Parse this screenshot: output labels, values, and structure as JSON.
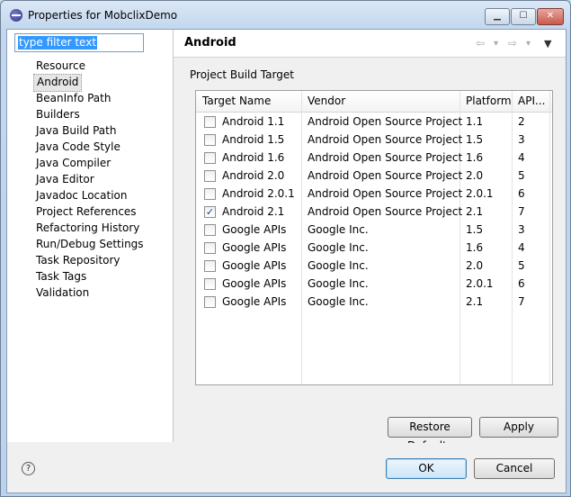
{
  "window": {
    "title": "Properties for MobclixDemo"
  },
  "filter": {
    "text": "type filter text"
  },
  "nav": {
    "items": [
      "Resource",
      "Android",
      "BeanInfo Path",
      "Builders",
      "Java Build Path",
      "Java Code Style",
      "Java Compiler",
      "Java Editor",
      "Javadoc Location",
      "Project References",
      "Refactoring History",
      "Run/Debug Settings",
      "Task Repository",
      "Task Tags",
      "Validation"
    ],
    "selected": "Android"
  },
  "page": {
    "title": "Android",
    "section_label": "Project Build Target",
    "back_icon": "⇦",
    "forward_icon": "⇨",
    "dropdown_icon": "▾",
    "menu_icon": "▼"
  },
  "table": {
    "columns": [
      "Target Name",
      "Vendor",
      "Platform",
      "API..."
    ],
    "rows": [
      {
        "checked": false,
        "name": "Android 1.1",
        "vendor": "Android Open Source Project",
        "platform": "1.1",
        "api": "2"
      },
      {
        "checked": false,
        "name": "Android 1.5",
        "vendor": "Android Open Source Project",
        "platform": "1.5",
        "api": "3"
      },
      {
        "checked": false,
        "name": "Android 1.6",
        "vendor": "Android Open Source Project",
        "platform": "1.6",
        "api": "4"
      },
      {
        "checked": false,
        "name": "Android 2.0",
        "vendor": "Android Open Source Project",
        "platform": "2.0",
        "api": "5"
      },
      {
        "checked": false,
        "name": "Android 2.0.1",
        "vendor": "Android Open Source Project",
        "platform": "2.0.1",
        "api": "6"
      },
      {
        "checked": true,
        "name": "Android 2.1",
        "vendor": "Android Open Source Project",
        "platform": "2.1",
        "api": "7"
      },
      {
        "checked": false,
        "name": "Google APIs",
        "vendor": "Google Inc.",
        "platform": "1.5",
        "api": "3"
      },
      {
        "checked": false,
        "name": "Google APIs",
        "vendor": "Google Inc.",
        "platform": "1.6",
        "api": "4"
      },
      {
        "checked": false,
        "name": "Google APIs",
        "vendor": "Google Inc.",
        "platform": "2.0",
        "api": "5"
      },
      {
        "checked": false,
        "name": "Google APIs",
        "vendor": "Google Inc.",
        "platform": "2.0.1",
        "api": "6"
      },
      {
        "checked": false,
        "name": "Google APIs",
        "vendor": "Google Inc.",
        "platform": "2.1",
        "api": "7"
      }
    ]
  },
  "buttons": {
    "restore_defaults": "Restore Defaults",
    "apply": "Apply",
    "ok": "OK",
    "cancel": "Cancel",
    "help_icon": "?"
  }
}
